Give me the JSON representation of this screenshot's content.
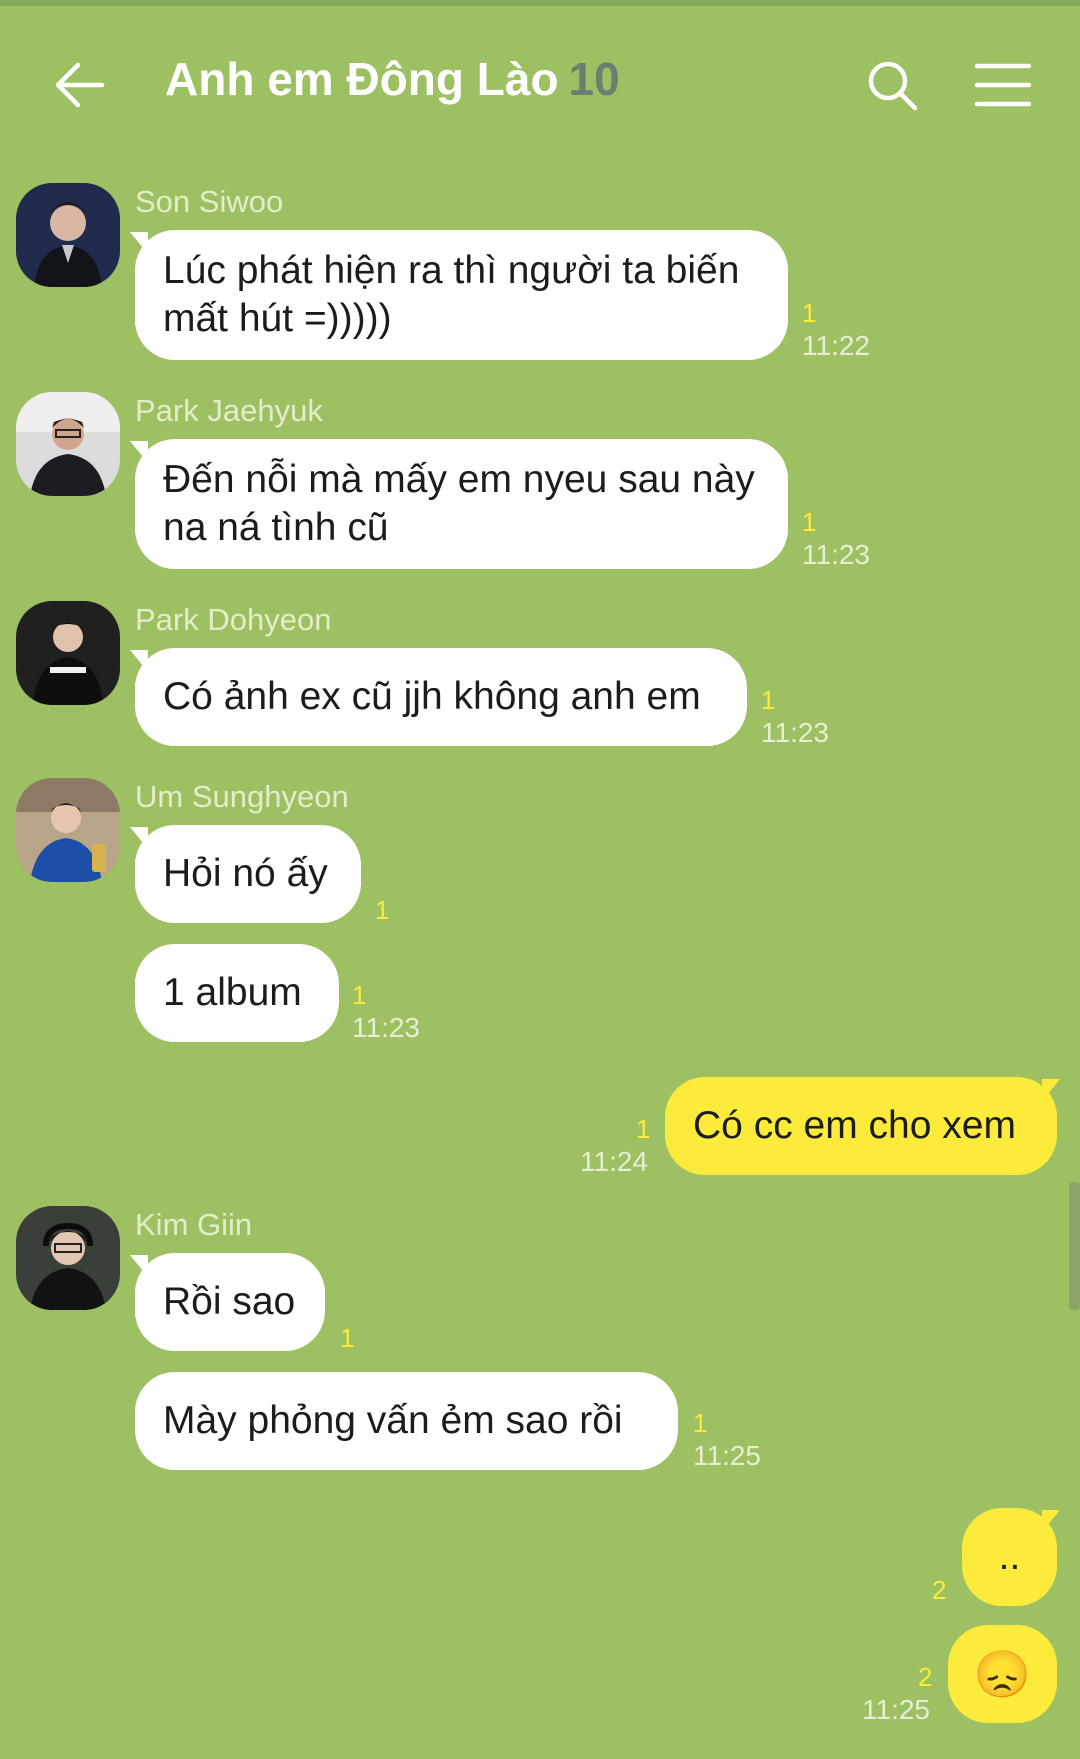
{
  "header": {
    "title": "Anh em Đông Lào",
    "member_count": "10"
  },
  "messages": [
    {
      "sender": "Son Siwoo",
      "text": "Lúc phát hiện ra thì người ta biến mất hút =)))))",
      "unread": "1",
      "time": "11:22"
    },
    {
      "sender": "Park Jaehyuk",
      "text": "Đến nỗi mà mấy em nyeu sau này na ná tình cũ",
      "unread": "1",
      "time": "11:23"
    },
    {
      "sender": "Park Dohyeon",
      "text": "Có ảnh ex cũ jjh không anh em",
      "unread": "1",
      "time": "11:23"
    },
    {
      "sender": "Um Sunghyeon",
      "text": "Hỏi nó ấy",
      "unread": "1",
      "time": ""
    },
    {
      "sender": "",
      "text": "1 album",
      "unread": "1",
      "time": "11:23"
    },
    {
      "sender": "me",
      "text": "Có cc em cho xem",
      "unread": "1",
      "time": "11:24"
    },
    {
      "sender": "Kim Giin",
      "text": "Rồi sao",
      "unread": "1",
      "time": ""
    },
    {
      "sender": "",
      "text": "Mày phỏng vấn ẻm sao rồi",
      "unread": "1",
      "time": "11:25"
    },
    {
      "sender": "me",
      "text": "..",
      "unread": "2",
      "time": ""
    },
    {
      "sender": "me",
      "text": "😞",
      "unread": "2",
      "time": "11:25"
    }
  ],
  "colors": {
    "background": "#9dc162",
    "my_bubble": "#fdeb3c",
    "other_bubble": "#ffffff",
    "unread": "#fdeb3c"
  },
  "icons": [
    "back-arrow-icon",
    "search-icon",
    "menu-icon"
  ]
}
